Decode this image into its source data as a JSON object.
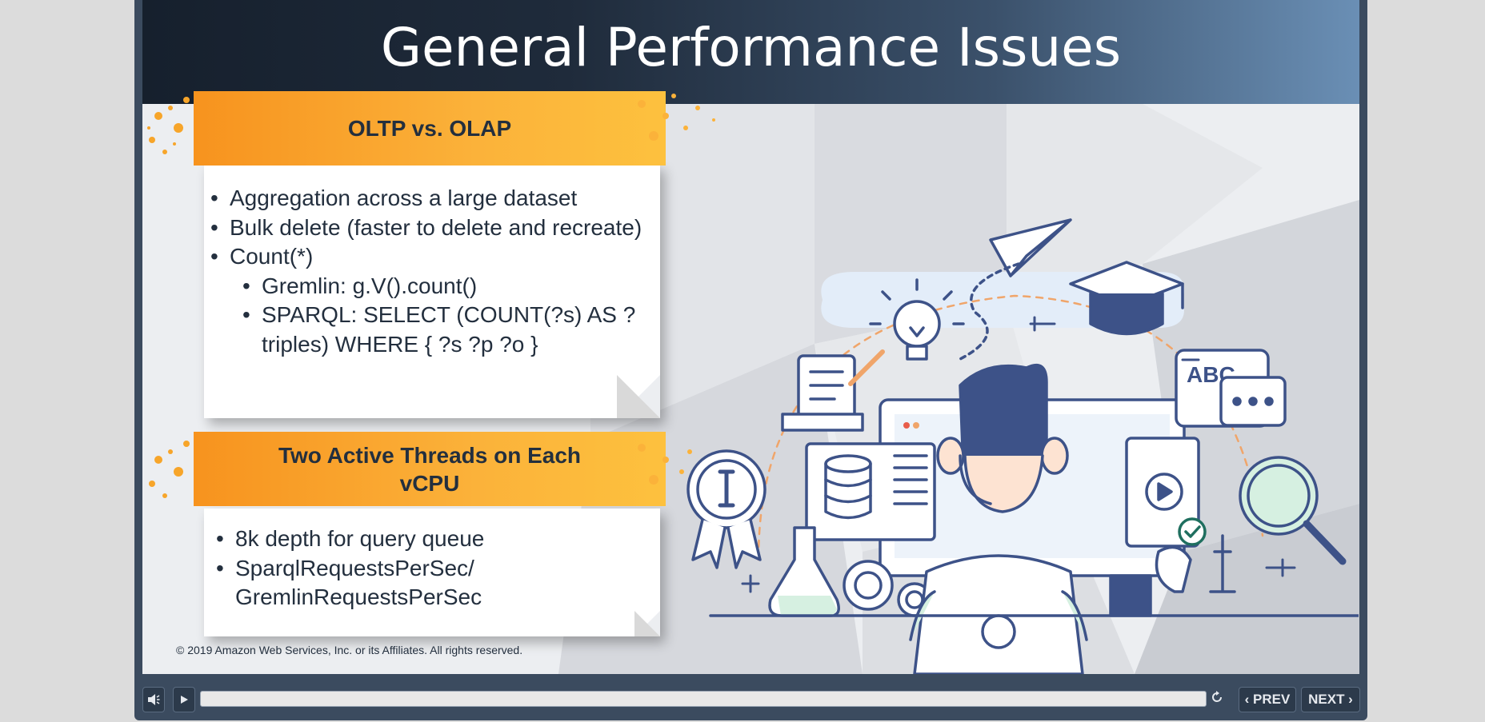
{
  "slide": {
    "title": "General Performance Issues",
    "section1": {
      "heading": "OLTP vs. OLAP",
      "bullets": [
        "Aggregation across a large dataset",
        "Bulk delete (faster to delete and recreate)",
        "Count(*)",
        "Gremlin: g.V().count()",
        "SPARQL: SELECT (COUNT(?s) AS ?triples) WHERE { ?s ?p ?o }"
      ]
    },
    "section2": {
      "heading": "Two Active Threads on Each vCPU",
      "bullets": [
        "8k depth for query queue",
        "SparqlRequestsPerSec/ GremlinRequestsPerSec"
      ]
    },
    "copyright": "© 2019 Amazon Web Services, Inc. or its Affiliates. All rights reserved.",
    "illustration_text": "ABC"
  },
  "player": {
    "mute_icon": "speaker-icon",
    "play_icon": "play-icon",
    "replay_icon": "replay-icon",
    "prev_label": "‹ PREV",
    "next_label": "NEXT ›",
    "progress": 0
  },
  "colors": {
    "accent": "#f7931e",
    "text": "#232f3e",
    "illustration": "#3d5288"
  }
}
